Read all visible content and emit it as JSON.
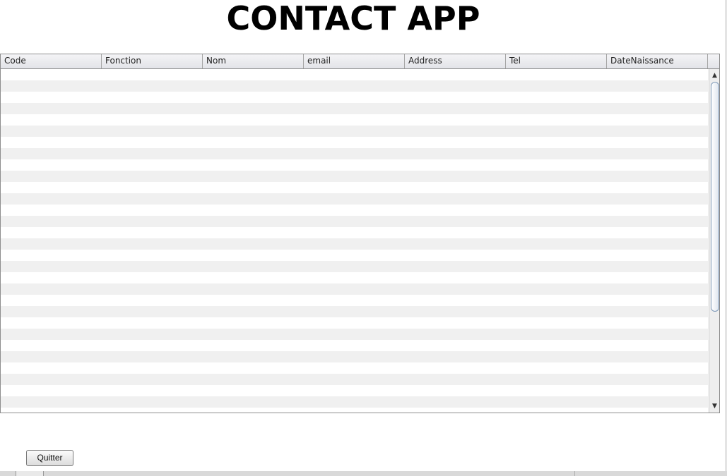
{
  "app": {
    "title": "CONTACT APP"
  },
  "table": {
    "columns": [
      "Code",
      "Fonction",
      "Nom",
      "email",
      "Address",
      "Tel",
      "DateNaissance"
    ],
    "rows": []
  },
  "scrollbar": {
    "up_arrow": "▲",
    "down_arrow": "▼"
  },
  "footer": {
    "quit_label": "Quitter"
  },
  "colors": {
    "stripe_alt": "#f0f0f0",
    "header_bg": "#e2e3e8",
    "border": "#8e8e8e"
  },
  "icons": {
    "scroll_up": "scroll-up-arrow-icon",
    "scroll_down": "scroll-down-arrow-icon"
  }
}
